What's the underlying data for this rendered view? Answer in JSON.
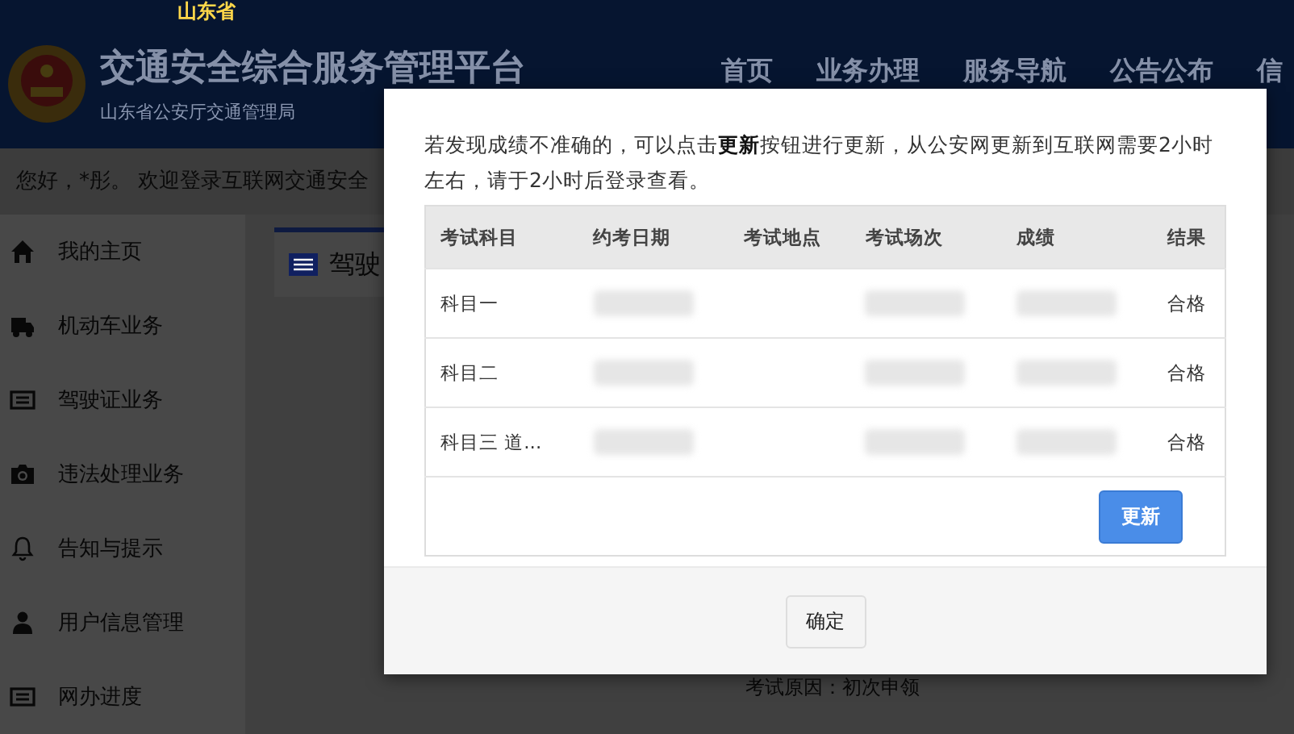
{
  "top_strip": {
    "region": "山东省"
  },
  "header": {
    "title": "交通安全综合服务管理平台",
    "subtitle": "山东省公安厅交通管理局",
    "nav": [
      {
        "label": "首页"
      },
      {
        "label": "业务办理"
      },
      {
        "label": "服务导航"
      },
      {
        "label": "公告公布"
      },
      {
        "label": "信"
      }
    ]
  },
  "welcome": "您好，*彤。 欢迎登录互联网交通安全",
  "sidebar": {
    "items": [
      {
        "label": "我的主页"
      },
      {
        "label": "机动车业务"
      },
      {
        "label": "驾驶证业务"
      },
      {
        "label": "违法处理业务"
      },
      {
        "label": "告知与提示"
      },
      {
        "label": "用户信息管理"
      },
      {
        "label": "网办进度"
      }
    ]
  },
  "content": {
    "tab": "驾驶",
    "footer_text": "考试原因：初次申领"
  },
  "dialog": {
    "message": "若发现成绩不准确的，可以点击**更新**按钮进行更新，从公安网更新到互联网需要2小时左右，请于2小时后登录查看。",
    "table": {
      "columns": [
        "考试科目",
        "约考日期",
        "考试地点",
        "考试场次",
        "成绩",
        "结果"
      ],
      "rows": [
        {
          "subject": "科目一",
          "redacted": [
            true,
            false,
            true,
            true
          ],
          "result": "合格"
        },
        {
          "subject": "科目二",
          "redacted": [
            true,
            false,
            true,
            true
          ],
          "result": "合格"
        },
        {
          "subject": "科目三 道...",
          "redacted": [
            true,
            false,
            true,
            true
          ],
          "result": "合格"
        }
      ]
    },
    "update_button": "更新",
    "ok_button": "确定"
  }
}
